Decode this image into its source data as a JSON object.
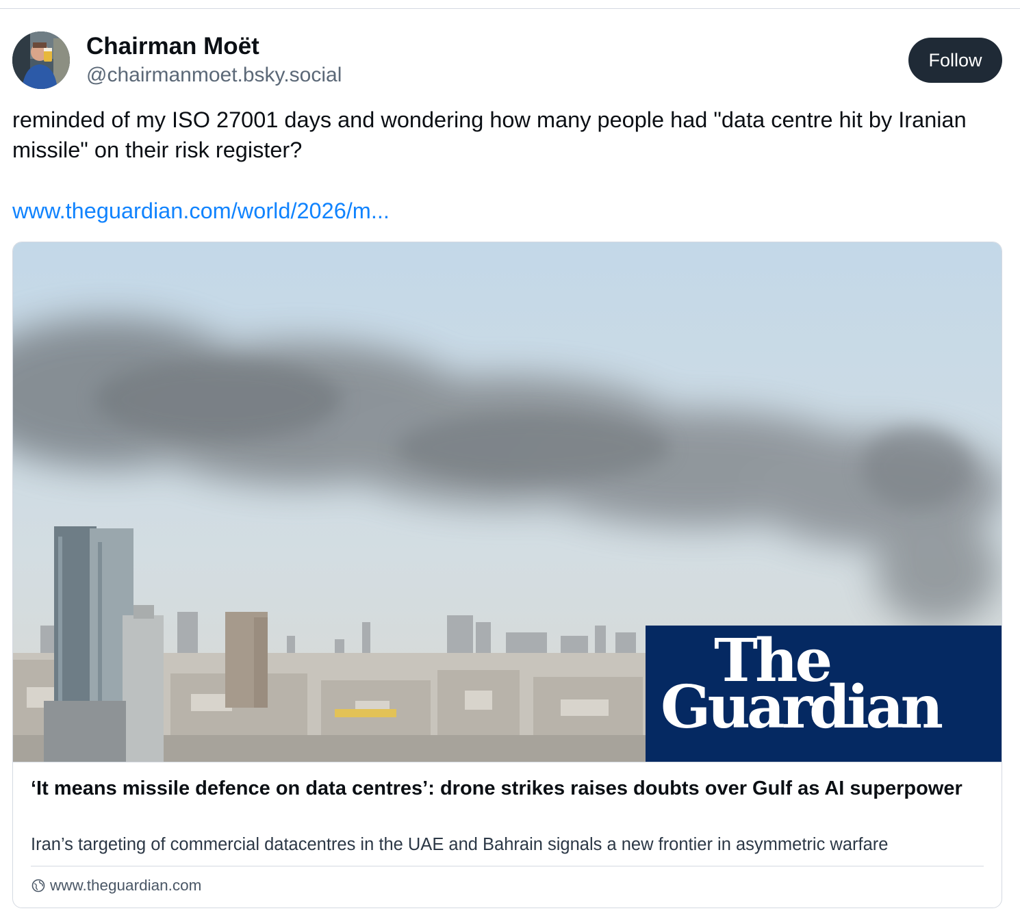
{
  "author": {
    "name": "Chairman Moët",
    "handle": "@chairmanmoet.bsky.social"
  },
  "follow_label": "Follow",
  "post": {
    "text": "reminded of my ISO 27001 days and wondering how many people had \"data centre hit by Iranian missile\" on their risk register?",
    "link": "www.theguardian.com/world/2026/m..."
  },
  "card": {
    "logo_line1": "The",
    "logo_line2": "Guardian",
    "title": "‘It means missile defence on data centres’: drone strikes raises doubts over Gulf as AI superpower",
    "description": "Iran’s targeting of commercial datacentres in the UAE and Bahrain signals a new frontier in asymmetric warfare",
    "domain": "www.theguardian.com"
  },
  "colors": {
    "link": "#1083fe",
    "follow_bg": "#1f2a36",
    "guardian_blue": "#052962",
    "handle": "#5b6877"
  },
  "icons": [
    "avatar-photo",
    "globe-icon"
  ]
}
